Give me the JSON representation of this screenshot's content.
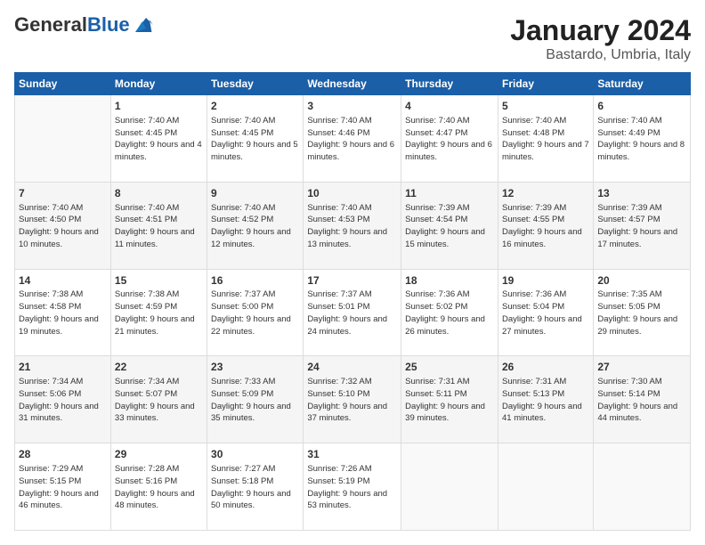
{
  "header": {
    "logo_general": "General",
    "logo_blue": "Blue",
    "month": "January 2024",
    "location": "Bastardo, Umbria, Italy"
  },
  "days_of_week": [
    "Sunday",
    "Monday",
    "Tuesday",
    "Wednesday",
    "Thursday",
    "Friday",
    "Saturday"
  ],
  "weeks": [
    [
      {
        "day": "",
        "sunrise": "",
        "sunset": "",
        "daylight": ""
      },
      {
        "day": "1",
        "sunrise": "Sunrise: 7:40 AM",
        "sunset": "Sunset: 4:45 PM",
        "daylight": "Daylight: 9 hours and 4 minutes."
      },
      {
        "day": "2",
        "sunrise": "Sunrise: 7:40 AM",
        "sunset": "Sunset: 4:45 PM",
        "daylight": "Daylight: 9 hours and 5 minutes."
      },
      {
        "day": "3",
        "sunrise": "Sunrise: 7:40 AM",
        "sunset": "Sunset: 4:46 PM",
        "daylight": "Daylight: 9 hours and 6 minutes."
      },
      {
        "day": "4",
        "sunrise": "Sunrise: 7:40 AM",
        "sunset": "Sunset: 4:47 PM",
        "daylight": "Daylight: 9 hours and 6 minutes."
      },
      {
        "day": "5",
        "sunrise": "Sunrise: 7:40 AM",
        "sunset": "Sunset: 4:48 PM",
        "daylight": "Daylight: 9 hours and 7 minutes."
      },
      {
        "day": "6",
        "sunrise": "Sunrise: 7:40 AM",
        "sunset": "Sunset: 4:49 PM",
        "daylight": "Daylight: 9 hours and 8 minutes."
      }
    ],
    [
      {
        "day": "7",
        "sunrise": "Sunrise: 7:40 AM",
        "sunset": "Sunset: 4:50 PM",
        "daylight": "Daylight: 9 hours and 10 minutes."
      },
      {
        "day": "8",
        "sunrise": "Sunrise: 7:40 AM",
        "sunset": "Sunset: 4:51 PM",
        "daylight": "Daylight: 9 hours and 11 minutes."
      },
      {
        "day": "9",
        "sunrise": "Sunrise: 7:40 AM",
        "sunset": "Sunset: 4:52 PM",
        "daylight": "Daylight: 9 hours and 12 minutes."
      },
      {
        "day": "10",
        "sunrise": "Sunrise: 7:40 AM",
        "sunset": "Sunset: 4:53 PM",
        "daylight": "Daylight: 9 hours and 13 minutes."
      },
      {
        "day": "11",
        "sunrise": "Sunrise: 7:39 AM",
        "sunset": "Sunset: 4:54 PM",
        "daylight": "Daylight: 9 hours and 15 minutes."
      },
      {
        "day": "12",
        "sunrise": "Sunrise: 7:39 AM",
        "sunset": "Sunset: 4:55 PM",
        "daylight": "Daylight: 9 hours and 16 minutes."
      },
      {
        "day": "13",
        "sunrise": "Sunrise: 7:39 AM",
        "sunset": "Sunset: 4:57 PM",
        "daylight": "Daylight: 9 hours and 17 minutes."
      }
    ],
    [
      {
        "day": "14",
        "sunrise": "Sunrise: 7:38 AM",
        "sunset": "Sunset: 4:58 PM",
        "daylight": "Daylight: 9 hours and 19 minutes."
      },
      {
        "day": "15",
        "sunrise": "Sunrise: 7:38 AM",
        "sunset": "Sunset: 4:59 PM",
        "daylight": "Daylight: 9 hours and 21 minutes."
      },
      {
        "day": "16",
        "sunrise": "Sunrise: 7:37 AM",
        "sunset": "Sunset: 5:00 PM",
        "daylight": "Daylight: 9 hours and 22 minutes."
      },
      {
        "day": "17",
        "sunrise": "Sunrise: 7:37 AM",
        "sunset": "Sunset: 5:01 PM",
        "daylight": "Daylight: 9 hours and 24 minutes."
      },
      {
        "day": "18",
        "sunrise": "Sunrise: 7:36 AM",
        "sunset": "Sunset: 5:02 PM",
        "daylight": "Daylight: 9 hours and 26 minutes."
      },
      {
        "day": "19",
        "sunrise": "Sunrise: 7:36 AM",
        "sunset": "Sunset: 5:04 PM",
        "daylight": "Daylight: 9 hours and 27 minutes."
      },
      {
        "day": "20",
        "sunrise": "Sunrise: 7:35 AM",
        "sunset": "Sunset: 5:05 PM",
        "daylight": "Daylight: 9 hours and 29 minutes."
      }
    ],
    [
      {
        "day": "21",
        "sunrise": "Sunrise: 7:34 AM",
        "sunset": "Sunset: 5:06 PM",
        "daylight": "Daylight: 9 hours and 31 minutes."
      },
      {
        "day": "22",
        "sunrise": "Sunrise: 7:34 AM",
        "sunset": "Sunset: 5:07 PM",
        "daylight": "Daylight: 9 hours and 33 minutes."
      },
      {
        "day": "23",
        "sunrise": "Sunrise: 7:33 AM",
        "sunset": "Sunset: 5:09 PM",
        "daylight": "Daylight: 9 hours and 35 minutes."
      },
      {
        "day": "24",
        "sunrise": "Sunrise: 7:32 AM",
        "sunset": "Sunset: 5:10 PM",
        "daylight": "Daylight: 9 hours and 37 minutes."
      },
      {
        "day": "25",
        "sunrise": "Sunrise: 7:31 AM",
        "sunset": "Sunset: 5:11 PM",
        "daylight": "Daylight: 9 hours and 39 minutes."
      },
      {
        "day": "26",
        "sunrise": "Sunrise: 7:31 AM",
        "sunset": "Sunset: 5:13 PM",
        "daylight": "Daylight: 9 hours and 41 minutes."
      },
      {
        "day": "27",
        "sunrise": "Sunrise: 7:30 AM",
        "sunset": "Sunset: 5:14 PM",
        "daylight": "Daylight: 9 hours and 44 minutes."
      }
    ],
    [
      {
        "day": "28",
        "sunrise": "Sunrise: 7:29 AM",
        "sunset": "Sunset: 5:15 PM",
        "daylight": "Daylight: 9 hours and 46 minutes."
      },
      {
        "day": "29",
        "sunrise": "Sunrise: 7:28 AM",
        "sunset": "Sunset: 5:16 PM",
        "daylight": "Daylight: 9 hours and 48 minutes."
      },
      {
        "day": "30",
        "sunrise": "Sunrise: 7:27 AM",
        "sunset": "Sunset: 5:18 PM",
        "daylight": "Daylight: 9 hours and 50 minutes."
      },
      {
        "day": "31",
        "sunrise": "Sunrise: 7:26 AM",
        "sunset": "Sunset: 5:19 PM",
        "daylight": "Daylight: 9 hours and 53 minutes."
      },
      {
        "day": "",
        "sunrise": "",
        "sunset": "",
        "daylight": ""
      },
      {
        "day": "",
        "sunrise": "",
        "sunset": "",
        "daylight": ""
      },
      {
        "day": "",
        "sunrise": "",
        "sunset": "",
        "daylight": ""
      }
    ]
  ]
}
